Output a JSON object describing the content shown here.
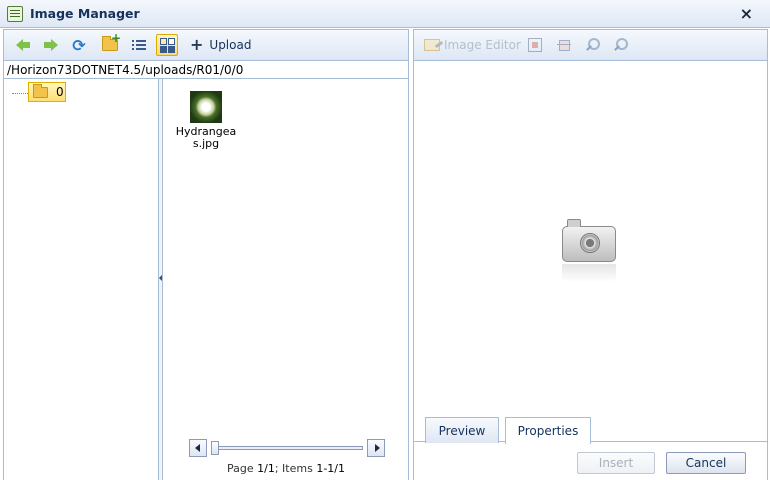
{
  "window": {
    "title": "Image Manager",
    "close_glyph": "×"
  },
  "left_toolbar": {
    "back_icon": "back-arrow-icon",
    "forward_icon": "forward-arrow-icon",
    "refresh_glyph": "⟳",
    "new_folder_icon": "new-folder-icon",
    "list_view_icon": "list-view-icon",
    "thumbnail_view_icon": "thumbnail-view-icon",
    "upload_glyph": "+",
    "upload_label": "Upload"
  },
  "path": "/Horizon73DOTNET4.5/uploads/R01/0/0",
  "tree": {
    "node_label": "0"
  },
  "files": [
    {
      "name": "Hydrangeas.jpg",
      "icon": "image-thumbnail"
    }
  ],
  "pager": {
    "page_label": "Page ",
    "page_value": "1/1",
    "items_label": "; Items ",
    "items_value": "1-1/1"
  },
  "right_toolbar": {
    "image_editor_label": "Image Editor",
    "best_fit_icon": "best-fit-icon",
    "actual_size_icon": "actual-size-icon",
    "zoom_in_icon": "zoom-in-icon",
    "zoom_out_icon": "zoom-out-icon"
  },
  "preview": {
    "placeholder_icon": "camera-icon"
  },
  "tabs": [
    {
      "label": "Preview"
    },
    {
      "label": "Properties",
      "selected": true
    }
  ],
  "buttons": {
    "insert": "Insert",
    "cancel": "Cancel"
  },
  "colors": {
    "title_text": "#15325a",
    "border": "#a7bcd9",
    "selected_bg": "#ffde74",
    "toolbar_bg": "#dde7f4"
  }
}
